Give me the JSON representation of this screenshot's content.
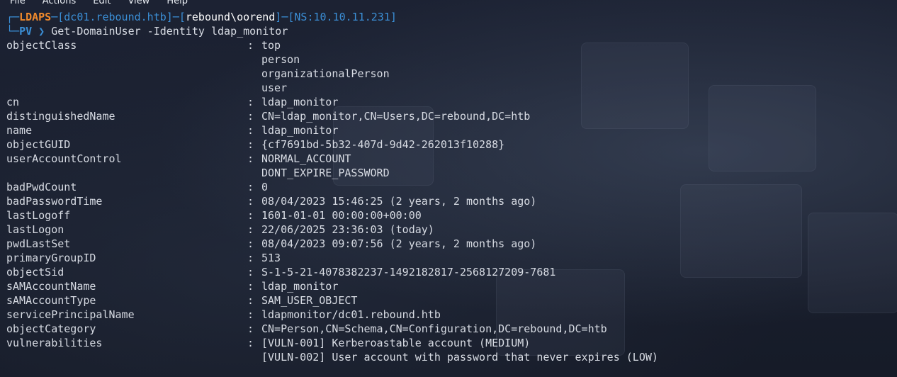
{
  "menu": [
    "File",
    "Actions",
    "Edit",
    "View",
    "Help"
  ],
  "prompt": {
    "corner_top": "┌─",
    "tool": "LDAPS",
    "host": "dc01.rebound.htb",
    "user": "rebound\\oorend",
    "ns": "NS:10.10.11.231",
    "corner_bottom": "└─",
    "mode": "PV",
    "arrow": "❯",
    "command": "Get-DomainUser -Identity ldap_monitor"
  },
  "attributes": [
    {
      "key": "objectClass",
      "values": [
        "top",
        "person",
        "organizationalPerson",
        "user"
      ]
    },
    {
      "key": "cn",
      "values": [
        "ldap_monitor"
      ]
    },
    {
      "key": "distinguishedName",
      "values": [
        "CN=ldap_monitor,CN=Users,DC=rebound,DC=htb"
      ]
    },
    {
      "key": "name",
      "values": [
        "ldap_monitor"
      ]
    },
    {
      "key": "objectGUID",
      "values": [
        "{cf7691bd-5b32-407d-9d42-262013f10288}"
      ]
    },
    {
      "key": "userAccountControl",
      "values": [
        "NORMAL_ACCOUNT",
        "DONT_EXPIRE_PASSWORD"
      ]
    },
    {
      "key": "badPwdCount",
      "values": [
        "0"
      ]
    },
    {
      "key": "badPasswordTime",
      "values": [
        "08/04/2023 15:46:25 (2 years, 2 months ago)"
      ]
    },
    {
      "key": "lastLogoff",
      "values": [
        "1601-01-01 00:00:00+00:00"
      ]
    },
    {
      "key": "lastLogon",
      "values": [
        "22/06/2025 23:36:03 (today)"
      ]
    },
    {
      "key": "pwdLastSet",
      "values": [
        "08/04/2023 09:07:56 (2 years, 2 months ago)"
      ]
    },
    {
      "key": "primaryGroupID",
      "values": [
        "513"
      ]
    },
    {
      "key": "objectSid",
      "values": [
        "S-1-5-21-4078382237-1492182817-2568127209-7681"
      ]
    },
    {
      "key": "sAMAccountName",
      "values": [
        "ldap_monitor"
      ]
    },
    {
      "key": "sAMAccountType",
      "values": [
        "SAM_USER_OBJECT"
      ]
    },
    {
      "key": "servicePrincipalName",
      "values": [
        "ldapmonitor/dc01.rebound.htb"
      ]
    },
    {
      "key": "objectCategory",
      "values": [
        "CN=Person,CN=Schema,CN=Configuration,DC=rebound,DC=htb"
      ]
    },
    {
      "key": "vulnerabilities",
      "values": [
        "[VULN-001] Kerberoastable account (MEDIUM)",
        "[VULN-002] User account with password that never expires (LOW)"
      ]
    }
  ],
  "separator": ":",
  "colors": {
    "background": "#1a2030",
    "prompt_blue": "#3b8fd6",
    "prompt_orange": "#f08a2c",
    "text": "#d7dbe3"
  }
}
